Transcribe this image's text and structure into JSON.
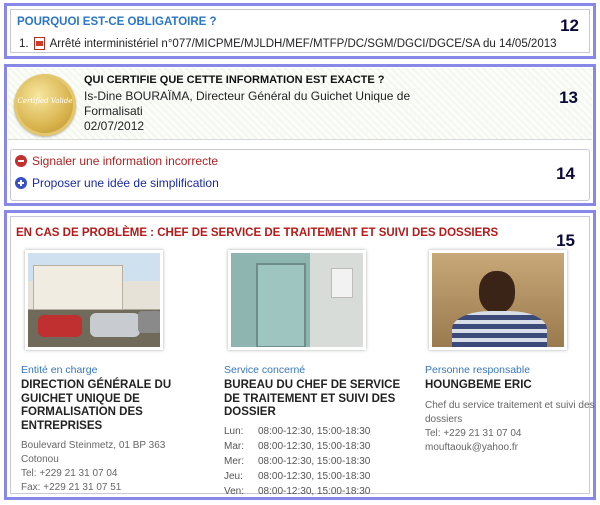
{
  "section_why": {
    "title": "POURQUOI EST-CE OBLIGATOIRE ?",
    "number": "12",
    "items": [
      {
        "index": "1.",
        "icon": "pdf-icon",
        "text": "Arrêté interministériel n°077/MICPME/MJLDH/MEF/MTFP/DC/SGM/DGCI/DGCE/SA du 14/05/2013"
      }
    ]
  },
  "section_certify": {
    "number": "13",
    "seal_text": "Certified Valide",
    "title": "QUI CERTIFIE QUE CETTE INFORMATION EST EXACTE ?",
    "person": "Is-Dine BOURAÏMA, Directeur Général du Guichet Unique de Formalisati",
    "date": "02/07/2012"
  },
  "section_actions": {
    "number": "14",
    "report_label": "Signaler une information incorrecte",
    "propose_label": "Proposer une idée de simplification"
  },
  "section_problem": {
    "number": "15",
    "title": "EN CAS DE PROBLÈME : CHEF DE SERVICE DE TRAITEMENT ET SUIVI DES DOSSIERS",
    "entity": {
      "label": "Entité en charge",
      "name": "DIRECTION GÉNÉRALE DU GUICHET UNIQUE DE FORMALISATION DES ENTREPRISES",
      "address": "Boulevard Steinmetz, 01 BP 363 Cotonou",
      "tel": "Tel: +229 21 31 07 04",
      "fax": "Fax: +229 21 31 07 51"
    },
    "service": {
      "label": "Service concerné",
      "name": "BUREAU DU CHEF DE SERVICE DE TRAITEMENT ET SUIVI DES DOSSIER",
      "hours": [
        {
          "day": "Lun:",
          "time": "08:00-12:30, 15:00-18:30"
        },
        {
          "day": "Mar:",
          "time": "08:00-12:30, 15:00-18:30"
        },
        {
          "day": "Mer:",
          "time": "08:00-12:30, 15:00-18:30"
        },
        {
          "day": "Jeu:",
          "time": "08:00-12:30, 15:00-18:30"
        },
        {
          "day": "Ven:",
          "time": "08:00-12:30, 15:00-18:30"
        }
      ]
    },
    "person": {
      "label": "Personne responsable",
      "name": "HOUNGBEME ERIC",
      "role": "Chef du service traitement et suivi des dossiers",
      "tel": "Tel: +229 21 31 07 04",
      "email": "mouftaouk@yahoo.fr"
    }
  }
}
